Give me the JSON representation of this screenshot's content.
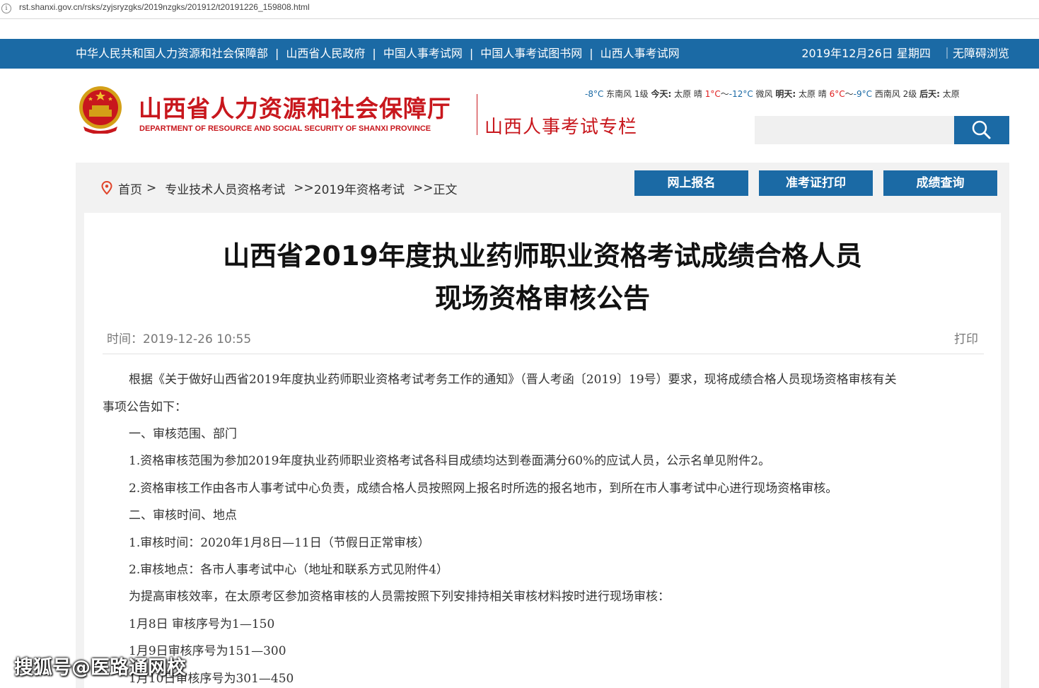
{
  "browser": {
    "url": "rst.shanxi.gov.cn/rsks/zyjsryzgks/2019nzgks/201912/t20191226_159808.html",
    "info_icon": "i"
  },
  "topnav": {
    "links": [
      "中华人民共和国人力资源和社会保障部",
      "山西省人民政府",
      "中国人事考试网",
      "中国人事考试图书网",
      "山西人事考试网"
    ],
    "separator": "|",
    "date": "2019年12月26日 星期四",
    "accessibility": "｜无障碍浏览"
  },
  "header": {
    "logo_cn": "山西省人力资源和社会保障厅",
    "logo_en": "DEPARTMENT OF RESOURCE AND SOCIAL SECURITY OF SHANXI PROVINCE",
    "column_title": "山西人事考试专栏",
    "weather": {
      "p1": "-8°C",
      "p2": " 东南风 1级 ",
      "today_label": "今天:",
      "p3": " 太原 晴 ",
      "today_hi": "1°C",
      "tilde1": "～",
      "today_lo": "-12°C",
      "p4": " 微风 ",
      "tomorrow_label": "明天:",
      "p5": " 太原 晴 ",
      "tomorrow_hi": "6°C",
      "tilde2": "～",
      "tomorrow_lo": "-9°C",
      "p6": " 西南风 2级 ",
      "after_label": "后天:",
      "p7": " 太原"
    },
    "search_placeholder": ""
  },
  "colors": {
    "brand_blue": "#1b6aa5",
    "brand_red": "#c8171d"
  },
  "breadcrumb": {
    "items": [
      "首页",
      "专业技术人员资格考试",
      "2019年资格考试",
      "正文"
    ],
    "seps": [
      ">",
      ">>",
      ">>"
    ]
  },
  "actions": {
    "register": "网上报名",
    "admit_card": "准考证打印",
    "score": "成绩查询"
  },
  "article": {
    "title_line1": "山西省2019年度执业药师职业资格考试成绩合格人员",
    "title_line2": "现场资格审核公告",
    "time": "时间：2019-12-26 10:55",
    "print": "打印",
    "para1_a": "根据《关于做好山西省2019年度执业药师职业资格考试考务工作的通知》（晋人考函〔2019〕19号）要求，现将成绩合格人员现场资格审核有关",
    "para1_b": "事项公告如下：",
    "h1": "一、审核范围、部门",
    "p1": "1.资格审核范围为参加2019年度执业药师职业资格考试各科目成绩均达到卷面满分60%的应试人员，公示名单见附件2。",
    "p2": "2.资格审核工作由各市人事考试中心负责，成绩合格人员按照网上报名时所选的报名地市，到所在市人事考试中心进行现场资格审核。",
    "h2": "二、审核时间、地点",
    "p3": "1.审核时间：2020年1月8日—11日（节假日正常审核）",
    "p4": "2.审核地点：各市人事考试中心（地址和联系方式见附件4）",
    "p5": "为提高审核效率，在太原考区参加资格审核的人员需按照下列安排持相关审核材料按时进行现场审核：",
    "p6": "1月8日 审核序号为1—150",
    "p7": "1月9日审核序号为151—300",
    "p8": "1月10日审核序号为301—450"
  },
  "watermark": "搜狐号@医路通网校"
}
